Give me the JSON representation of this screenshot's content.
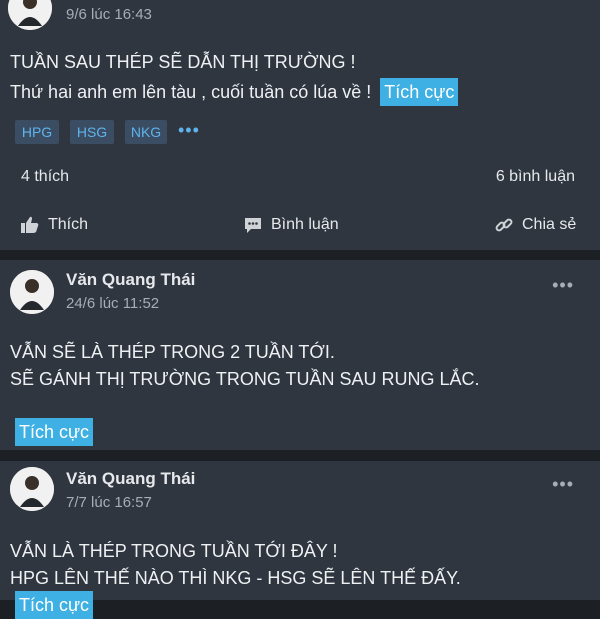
{
  "posts": [
    {
      "time": "9/6 lúc 16:43",
      "lines": [
        "TUẦN SAU THÉP SẼ DẪN THỊ TRƯỜNG !",
        "Thứ hai anh em lên tàu , cuối tuần có lúa về !"
      ],
      "sentiment": "Tích cực",
      "tags": [
        "HPG",
        "HSG",
        "NKG"
      ],
      "more_tags": "•••",
      "likes": "4 thích",
      "comments": "6 bình luận",
      "actions": {
        "like": "Thích",
        "comment": "Bình luận",
        "share": "Chia sẻ"
      }
    },
    {
      "author": "Văn Quang Thái",
      "time": "24/6 lúc 11:52",
      "more": "•••",
      "lines": [
        "VẪN SẼ LÀ THÉP TRONG 2 TUẦN TỚI.",
        "SẼ GÁNH THỊ TRƯỜNG TRONG TUẦN SAU RUNG LẮC."
      ],
      "sentiment": "Tích cực"
    },
    {
      "author": "Văn Quang Thái",
      "time": "7/7 lúc 16:57",
      "more": "•••",
      "lines": [
        "VẪN LÀ THÉP TRONG TUẦN TỚI ĐÂY !",
        "HPG LÊN THẾ NÀO THÌ NKG - HSG SẼ LÊN THẾ ĐẤY."
      ],
      "sentiment": "Tích cực"
    }
  ],
  "colors": {
    "background": "#1c1f24",
    "card": "#2f3640",
    "accent": "#3fb0e3",
    "tag_bg": "#3b4d62",
    "tag_text": "#5fb3ec"
  },
  "icons": {
    "avatar": "avatar-portrait",
    "like": "thumbs-up-icon",
    "comment": "speech-bubble-icon",
    "share": "link-icon",
    "more": "more-options-icon"
  }
}
